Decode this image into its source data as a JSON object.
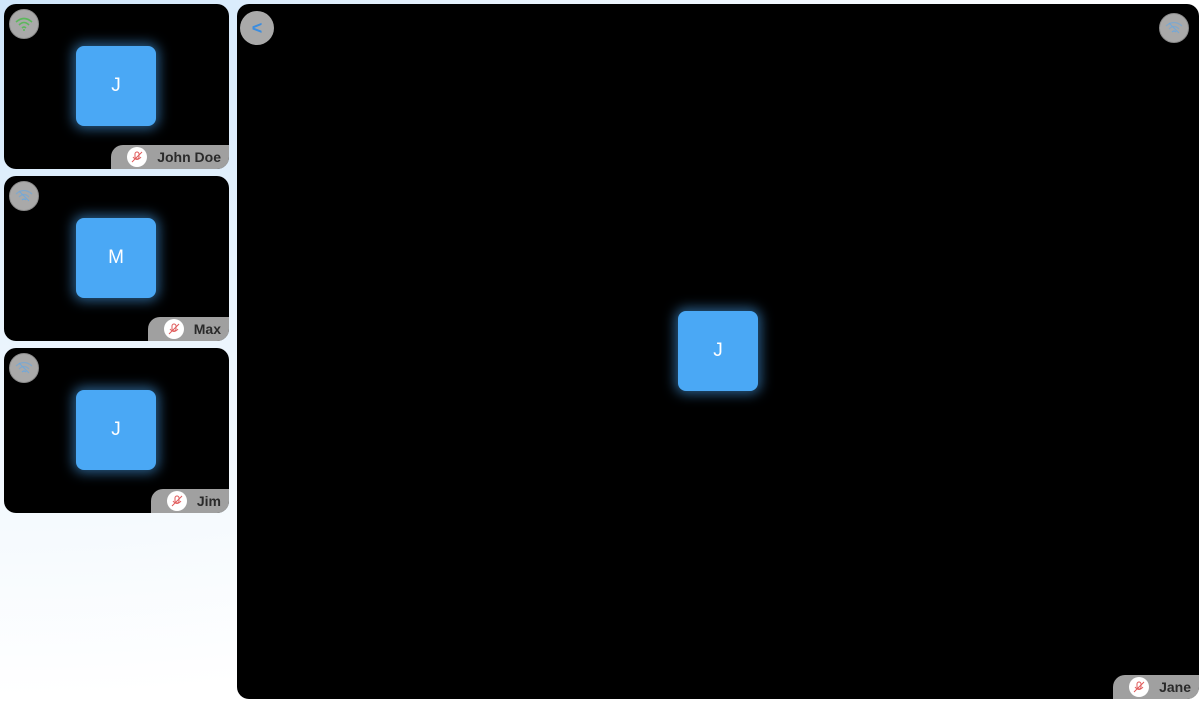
{
  "participants": [
    {
      "name": "John Doe",
      "initial": "J",
      "signal": "wifi-strong-icon",
      "mic": "mic-muted-icon"
    },
    {
      "name": "Max",
      "initial": "M",
      "signal": "wifi-weak-icon",
      "mic": "mic-muted-icon"
    },
    {
      "name": "Jim",
      "initial": "J",
      "signal": "wifi-weak-icon",
      "mic": "mic-muted-icon"
    }
  ],
  "main": {
    "name": "Jane",
    "initial": "J",
    "signal": "wifi-weak-icon",
    "mic": "mic-muted-icon"
  },
  "back_label": "<",
  "colors": {
    "avatar": "#4aa8f5",
    "tile_bg": "#000000",
    "nameplate": "#a0a0a0",
    "muted_mic": "#e05a5a",
    "signal_strong": "#5cb85c",
    "signal_weak": "#6fa8dc"
  }
}
